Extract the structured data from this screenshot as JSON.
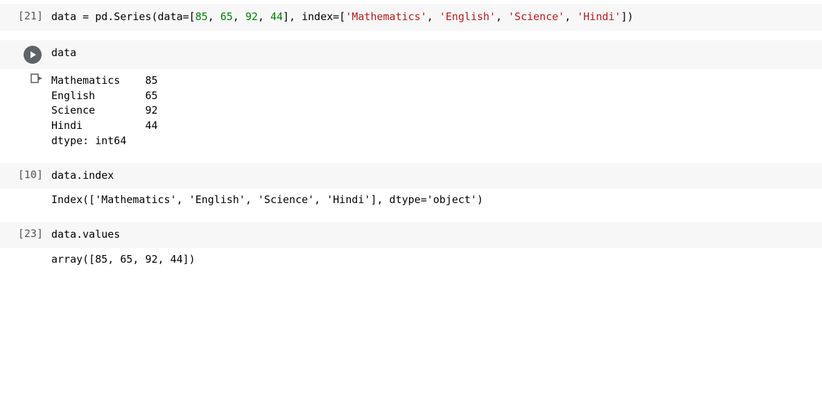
{
  "cells": [
    {
      "exec_label": "[21]",
      "code_tokens": [
        {
          "t": "plain",
          "v": "data = pd.Series(data=["
        },
        {
          "t": "num",
          "v": "85"
        },
        {
          "t": "plain",
          "v": ", "
        },
        {
          "t": "num",
          "v": "65"
        },
        {
          "t": "plain",
          "v": ", "
        },
        {
          "t": "num",
          "v": "92"
        },
        {
          "t": "plain",
          "v": ", "
        },
        {
          "t": "num",
          "v": "44"
        },
        {
          "t": "plain",
          "v": "], index=["
        },
        {
          "t": "str",
          "v": "'Mathematics'"
        },
        {
          "t": "plain",
          "v": ", "
        },
        {
          "t": "str",
          "v": "'English'"
        },
        {
          "t": "plain",
          "v": ", "
        },
        {
          "t": "str",
          "v": "'Science'"
        },
        {
          "t": "plain",
          "v": ", "
        },
        {
          "t": "str",
          "v": "'Hindi'"
        },
        {
          "t": "plain",
          "v": "])"
        }
      ]
    },
    {
      "run_button": true,
      "code_tokens": [
        {
          "t": "plain",
          "v": "data"
        }
      ],
      "output_lines": [
        "Mathematics    85",
        "English        65",
        "Science        92",
        "Hindi          44",
        "dtype: int64"
      ]
    },
    {
      "exec_label": "[10]",
      "code_tokens": [
        {
          "t": "plain",
          "v": "data.index"
        }
      ],
      "output_lines": [
        "Index(['Mathematics', 'English', 'Science', 'Hindi'], dtype='object')"
      ]
    },
    {
      "exec_label": "[23]",
      "code_tokens": [
        {
          "t": "plain",
          "v": "data.values"
        }
      ],
      "output_lines": [
        "array([85, 65, 92, 44])"
      ]
    }
  ]
}
